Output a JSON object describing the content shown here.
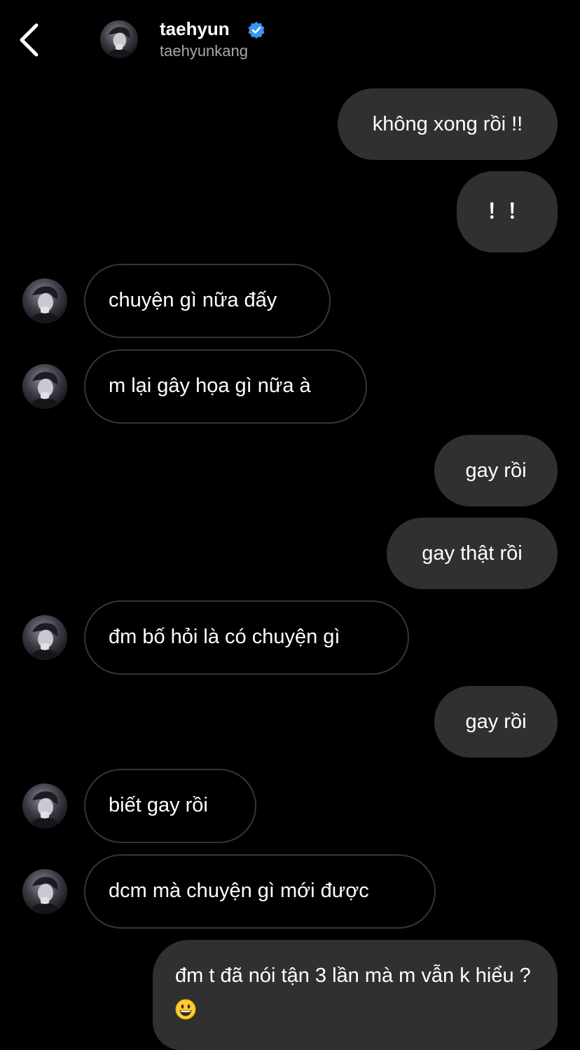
{
  "header": {
    "name": "taehyun",
    "handle": "taehyunkang",
    "verified_color": "#3897f0"
  },
  "colors": {
    "background": "#000000",
    "outgoing_bubble": "#303030",
    "incoming_border": "#363636",
    "secondary_text": "#a8a8a8"
  },
  "messages": [
    {
      "side": "outgoing",
      "text": "không xong rồi !!"
    },
    {
      "side": "outgoing",
      "text": "！！"
    },
    {
      "side": "incoming",
      "text": "chuyện gì nữa đấy"
    },
    {
      "side": "incoming",
      "text": "m lại gây họa gì nữa à"
    },
    {
      "side": "outgoing",
      "text": "gay rồi"
    },
    {
      "side": "outgoing",
      "text": "gay thật rồi"
    },
    {
      "side": "incoming",
      "text": "đm bố hỏi là có chuyện gì"
    },
    {
      "side": "outgoing",
      "text": "gay rồi"
    },
    {
      "side": "incoming",
      "text": "biết gay rồi"
    },
    {
      "side": "incoming",
      "text": "dcm mà chuyện gì mới được"
    },
    {
      "side": "outgoing",
      "text": "đm t đã nói tận 3 lần mà m vẫn k hiểu ?",
      "emoji": "grinning-face"
    }
  ]
}
